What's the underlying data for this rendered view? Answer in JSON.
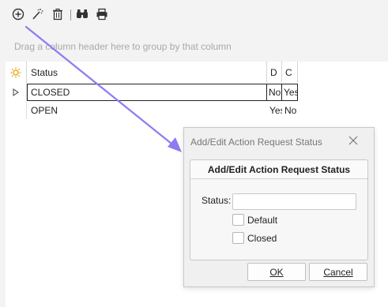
{
  "toolbar": {
    "buttons": [
      {
        "icon": "add-circle-icon"
      },
      {
        "icon": "edit-wand-icon"
      },
      {
        "icon": "trash-icon"
      },
      {
        "icon": "binoculars-icon"
      },
      {
        "icon": "printer-icon"
      }
    ]
  },
  "group_panel": {
    "hint": "Drag a column header here to group by that column"
  },
  "grid": {
    "columns": [
      "Status",
      "D",
      "C"
    ],
    "rows": [
      {
        "status": "CLOSED",
        "d": "No",
        "c": "Yes",
        "selected": true
      },
      {
        "status": "OPEN",
        "d": "Yes",
        "c": "No",
        "selected": false
      }
    ]
  },
  "dialog": {
    "title": "Add/Edit Action Request Status",
    "group_caption": "Add/Edit Action Request Status",
    "status_label": "Status:",
    "status_value": "",
    "default_label": "Default",
    "default_checked": false,
    "closed_label": "Closed",
    "closed_checked": false,
    "ok_label": "OK",
    "cancel_label": "Cancel"
  },
  "colors": {
    "arrow": "#8c7cf0",
    "header_icon": "#e8a000"
  }
}
